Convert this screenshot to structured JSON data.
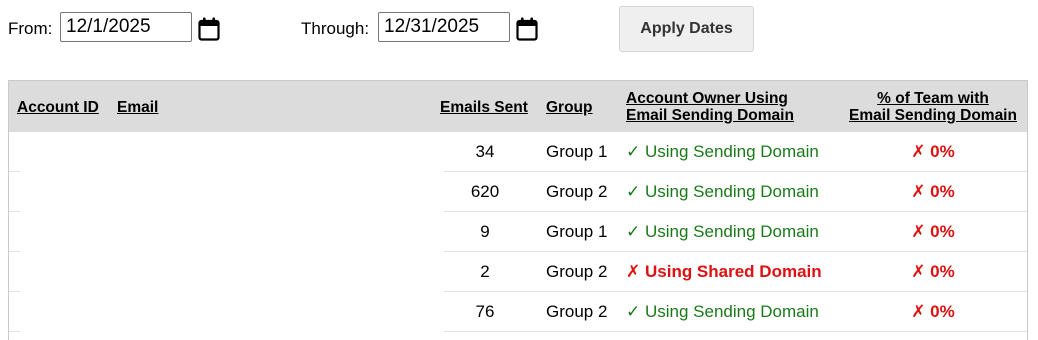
{
  "filters": {
    "from_label": "From:",
    "from_value": "12/1/2025",
    "through_label": "Through:",
    "through_value": "12/31/2025",
    "apply_label": "Apply Dates"
  },
  "table": {
    "columns": {
      "account_id": "Account ID",
      "email": "Email",
      "emails_sent": "Emails Sent",
      "group": "Group",
      "owner_line1": "Account Owner Using",
      "owner_line2": "Email Sending Domain",
      "team_line1": "% of Team with",
      "team_line2": "Email Sending Domain"
    },
    "rows": [
      {
        "emails_sent": "34",
        "group": "Group 1",
        "domain_mark": "✓",
        "domain_text": "Using Sending Domain",
        "domain_status": "ok",
        "team_pct": "✗ 0%"
      },
      {
        "emails_sent": "620",
        "group": "Group 2",
        "domain_mark": "✓",
        "domain_text": "Using Sending Domain",
        "domain_status": "ok",
        "team_pct": "✗ 0%"
      },
      {
        "emails_sent": "9",
        "group": "Group 1",
        "domain_mark": "✓",
        "domain_text": "Using Sending Domain",
        "domain_status": "ok",
        "team_pct": "✗ 0%"
      },
      {
        "emails_sent": "2",
        "group": "Group 2",
        "domain_mark": "✗",
        "domain_text": "Using Shared Domain",
        "domain_status": "bad",
        "team_pct": "✗ 0%"
      },
      {
        "emails_sent": "76",
        "group": "Group 2",
        "domain_mark": "✓",
        "domain_text": "Using Sending Domain",
        "domain_status": "ok",
        "team_pct": "✗ 0%"
      }
    ]
  },
  "colors": {
    "ok": "#1a7a1a",
    "bad": "#e01010",
    "header_bg": "#dcdcdc"
  },
  "icons": {
    "calendar": "calendar-icon"
  }
}
